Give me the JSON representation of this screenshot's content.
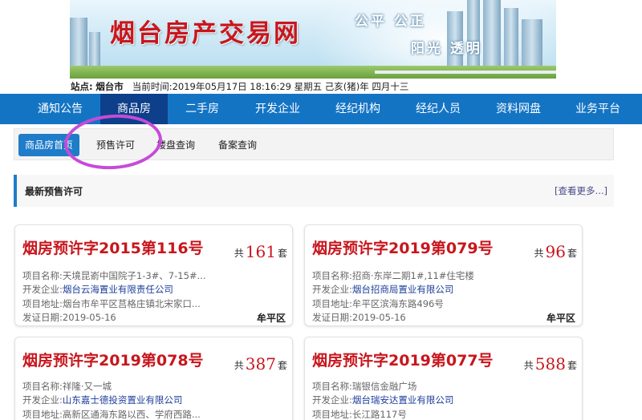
{
  "header": {
    "site_title": "烟台房产交易网",
    "slogan_line1": "公平 公正",
    "slogan_line2": "阳光 透明"
  },
  "infobar": {
    "station_label": "站点:",
    "station_value": "烟台市",
    "time_label": "当前时间:",
    "time_value": "2019年05月17日 18:16:29 星期五 己亥(猪)年 四月十三"
  },
  "main_nav": {
    "items": [
      {
        "label": "通知公告"
      },
      {
        "label": "商品房"
      },
      {
        "label": "二手房"
      },
      {
        "label": "开发企业"
      },
      {
        "label": "经纪机构"
      },
      {
        "label": "经纪人员"
      },
      {
        "label": "资料网盘"
      },
      {
        "label": "业务平台"
      }
    ],
    "active_index": 1
  },
  "sub_nav": {
    "items": [
      {
        "label": "商品房首页"
      },
      {
        "label": "预售许可"
      },
      {
        "label": "楼盘查询"
      },
      {
        "label": "备案查询"
      }
    ],
    "active_index": 0
  },
  "section": {
    "title": "最新预售许可",
    "more_label": "[查看更多...]"
  },
  "card_labels": {
    "total_prefix": "共",
    "unit": "套",
    "project_name": "项目名称:",
    "developer": "开发企业:",
    "address": "项目地址:",
    "issue_date": "发证日期:"
  },
  "cards": [
    {
      "permit_no": "烟房预许字2015第116号",
      "total": "161",
      "project_name": "天境昆嵛中国院子1-3#、7-15#...",
      "developer": "烟台云海置业有限责任公司",
      "address": "烟台市牟平区莒格庄镇北宋家口...",
      "issue_date": "2019-05-16",
      "district": "牟平区"
    },
    {
      "permit_no": "烟房预许字2019第079号",
      "total": "96",
      "project_name": "招商·东岸二期1#,11#住宅楼",
      "developer": "烟台招商局置业有限公司",
      "address": "牟平区滨海东路496号",
      "issue_date": "2019-05-16",
      "district": "牟平区"
    },
    {
      "permit_no": "烟房预许字2019第078号",
      "total": "387",
      "project_name": "祥隆·又一城",
      "developer": "山东嘉士德投资置业有限公司",
      "address": "高新区通海东路以西、学府西路...",
      "issue_date": "",
      "district": ""
    },
    {
      "permit_no": "烟房预许字2019第077号",
      "total": "588",
      "project_name": "瑞银信金融广场",
      "developer": "烟台瑞安达置业有限公司",
      "address": "长江路117号",
      "issue_date": "",
      "district": ""
    }
  ],
  "colors": {
    "nav_bg": "#1474c4",
    "nav_active": "#0d3f8a",
    "subnav_active": "#1e7cc8",
    "accent_red": "#c8161d",
    "annotation_circle": "#c64bd8"
  }
}
